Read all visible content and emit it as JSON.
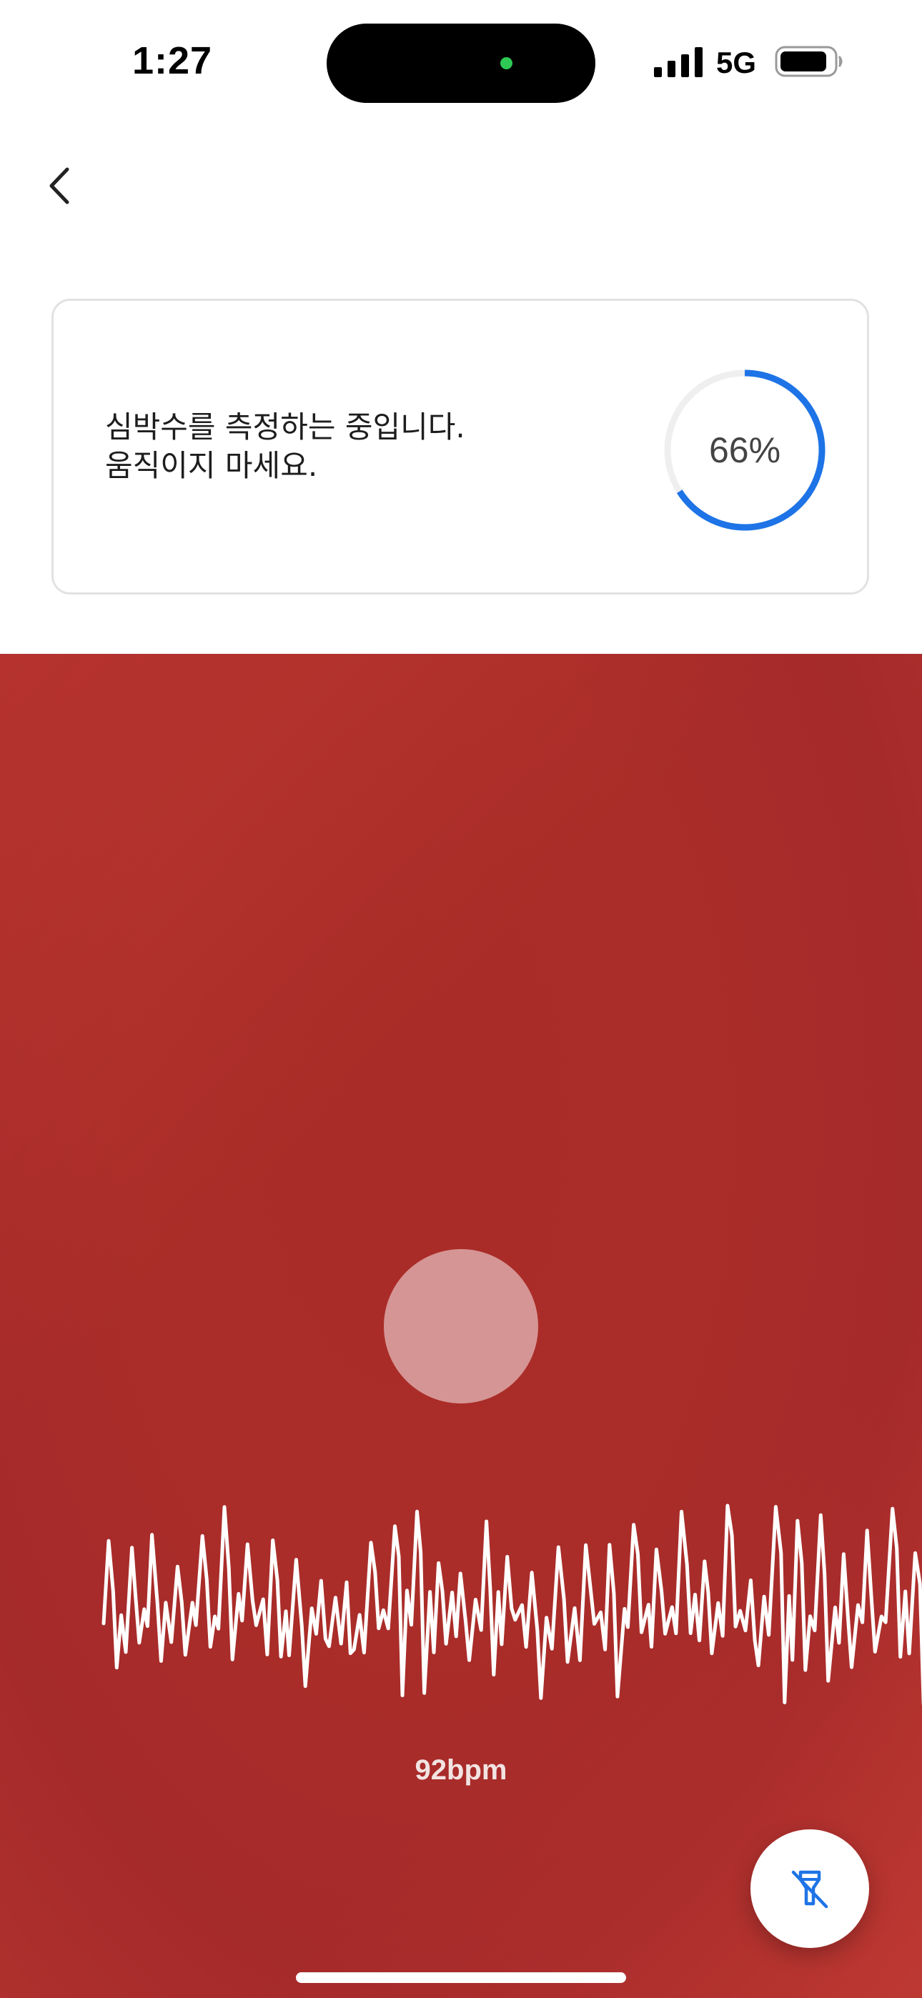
{
  "status_bar": {
    "time": "1:27",
    "network": "5G"
  },
  "nav": {
    "back_icon": "chevron-left-icon"
  },
  "measure_card": {
    "message_line1": "심박수를 측정하는 중입니다.",
    "message_line2": "움직이지 마세요.",
    "progress_percent": 66,
    "progress_label": "66%",
    "progress_color": "#1e74e6"
  },
  "measurement": {
    "bpm_label": "92bpm",
    "background_color": "#a92c28",
    "flash_icon": "flashlight-off-icon"
  }
}
